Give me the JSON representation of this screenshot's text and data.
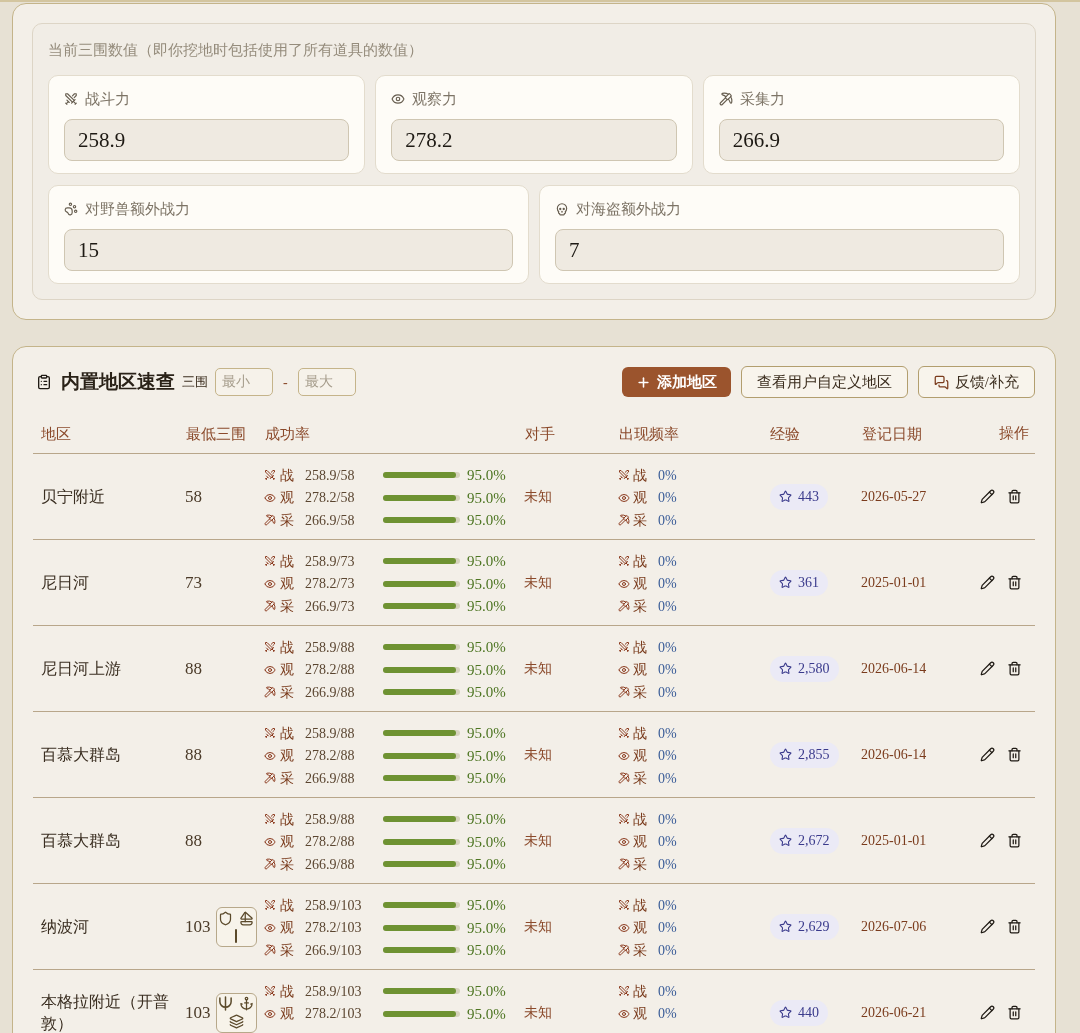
{
  "stats_panel": {
    "caption": "当前三围数值（即你挖地时包括使用了所有道具的数值）",
    "main_stats": [
      {
        "kind": "combat",
        "label": "战斗力",
        "value": "258.9"
      },
      {
        "kind": "observe",
        "label": "观察力",
        "value": "278.2"
      },
      {
        "kind": "gather",
        "label": "采集力",
        "value": "266.9"
      }
    ],
    "bonus_stats": [
      {
        "kind": "beast",
        "label": "对野兽额外战力",
        "value": "15"
      },
      {
        "kind": "pirate",
        "label": "对海盗额外战力",
        "value": "7"
      }
    ]
  },
  "regions_panel": {
    "title": "内置地区速查",
    "filter": {
      "label": "三围",
      "min_placeholder": "最小",
      "separator": "-",
      "max_placeholder": "最大"
    },
    "buttons": [
      {
        "kind": "add",
        "label": "添加地区"
      },
      {
        "kind": "plain",
        "label": "查看用户自定义地区"
      },
      {
        "kind": "feedback",
        "label": "反馈/补充"
      }
    ],
    "table": {
      "columns": [
        "地区",
        "最低三围",
        "成功率",
        "对手",
        "出现频率",
        "经验",
        "登记日期",
        "操作"
      ],
      "rows": [
        {
          "region": "贝宁附近",
          "min_stat": "58",
          "success": [
            {
              "kind": "combat",
              "label": "战",
              "ratio": "258.9/58",
              "level": 0.95,
              "reading": "95.0%"
            },
            {
              "kind": "observe",
              "label": "观",
              "ratio": "278.2/58",
              "level": 0.95,
              "reading": "95.0%"
            },
            {
              "kind": "gather",
              "label": "采",
              "ratio": "266.9/58",
              "level": 0.95,
              "reading": "95.0%"
            }
          ],
          "opponent": "未知",
          "frequency": [
            {
              "kind": "combat",
              "label": "战",
              "reading": "0%"
            },
            {
              "kind": "observe",
              "label": "观",
              "reading": "0%"
            },
            {
              "kind": "gather",
              "label": "采",
              "reading": "0%"
            }
          ],
          "exp": "443",
          "date": "2026-05-27"
        },
        {
          "region": "尼日河",
          "min_stat": "73",
          "success": [
            {
              "kind": "combat",
              "label": "战",
              "ratio": "258.9/73",
              "level": 0.95,
              "reading": "95.0%"
            },
            {
              "kind": "observe",
              "label": "观",
              "ratio": "278.2/73",
              "level": 0.95,
              "reading": "95.0%"
            },
            {
              "kind": "gather",
              "label": "采",
              "ratio": "266.9/73",
              "level": 0.95,
              "reading": "95.0%"
            }
          ],
          "opponent": "未知",
          "frequency": [
            {
              "kind": "combat",
              "label": "战",
              "reading": "0%"
            },
            {
              "kind": "observe",
              "label": "观",
              "reading": "0%"
            },
            {
              "kind": "gather",
              "label": "采",
              "reading": "0%"
            }
          ],
          "exp": "361",
          "date": "2025-01-01"
        },
        {
          "region": "尼日河上游",
          "min_stat": "88",
          "success": [
            {
              "kind": "combat",
              "label": "战",
              "ratio": "258.9/88",
              "level": 0.95,
              "reading": "95.0%"
            },
            {
              "kind": "observe",
              "label": "观",
              "ratio": "278.2/88",
              "level": 0.95,
              "reading": "95.0%"
            },
            {
              "kind": "gather",
              "label": "采",
              "ratio": "266.9/88",
              "level": 0.95,
              "reading": "95.0%"
            }
          ],
          "opponent": "未知",
          "frequency": [
            {
              "kind": "combat",
              "label": "战",
              "reading": "0%"
            },
            {
              "kind": "observe",
              "label": "观",
              "reading": "0%"
            },
            {
              "kind": "gather",
              "label": "采",
              "reading": "0%"
            }
          ],
          "exp": "2,580",
          "date": "2026-06-14"
        },
        {
          "region": "百慕大群岛",
          "min_stat": "88",
          "success": [
            {
              "kind": "combat",
              "label": "战",
              "ratio": "258.9/88",
              "level": 0.95,
              "reading": "95.0%"
            },
            {
              "kind": "observe",
              "label": "观",
              "ratio": "278.2/88",
              "level": 0.95,
              "reading": "95.0%"
            },
            {
              "kind": "gather",
              "label": "采",
              "ratio": "266.9/88",
              "level": 0.95,
              "reading": "95.0%"
            }
          ],
          "opponent": "未知",
          "frequency": [
            {
              "kind": "combat",
              "label": "战",
              "reading": "0%"
            },
            {
              "kind": "observe",
              "label": "观",
              "reading": "0%"
            },
            {
              "kind": "gather",
              "label": "采",
              "reading": "0%"
            }
          ],
          "exp": "2,855",
          "date": "2026-06-14"
        },
        {
          "region": "百慕大群岛",
          "min_stat": "88",
          "success": [
            {
              "kind": "combat",
              "label": "战",
              "ratio": "258.9/88",
              "level": 0.95,
              "reading": "95.0%"
            },
            {
              "kind": "observe",
              "label": "观",
              "ratio": "278.2/88",
              "level": 0.95,
              "reading": "95.0%"
            },
            {
              "kind": "gather",
              "label": "采",
              "ratio": "266.9/88",
              "level": 0.95,
              "reading": "95.0%"
            }
          ],
          "opponent": "未知",
          "frequency": [
            {
              "kind": "combat",
              "label": "战",
              "reading": "0%"
            },
            {
              "kind": "observe",
              "label": "观",
              "reading": "0%"
            },
            {
              "kind": "gather",
              "label": "采",
              "reading": "0%"
            }
          ],
          "exp": "2,672",
          "date": "2025-01-01"
        },
        {
          "region": "纳波河",
          "min_stat": "103",
          "tags": [
            {
              "kind": "shield"
            },
            {
              "kind": "sailboat"
            },
            {
              "kind": "line"
            }
          ],
          "success": [
            {
              "kind": "combat",
              "label": "战",
              "ratio": "258.9/103",
              "level": 0.95,
              "reading": "95.0%"
            },
            {
              "kind": "observe",
              "label": "观",
              "ratio": "278.2/103",
              "level": 0.95,
              "reading": "95.0%"
            },
            {
              "kind": "gather",
              "label": "采",
              "ratio": "266.9/103",
              "level": 0.95,
              "reading": "95.0%"
            }
          ],
          "opponent": "未知",
          "frequency": [
            {
              "kind": "combat",
              "label": "战",
              "reading": "0%"
            },
            {
              "kind": "observe",
              "label": "观",
              "reading": "0%"
            },
            {
              "kind": "gather",
              "label": "采",
              "reading": "0%"
            }
          ],
          "exp": "2,629",
          "date": "2026-07-06"
        },
        {
          "region": "本格拉附近（开普敦）",
          "min_stat": "103",
          "tags": [
            {
              "kind": "trident"
            },
            {
              "kind": "anchor"
            },
            {
              "kind": "layers"
            }
          ],
          "success": [
            {
              "kind": "combat",
              "label": "战",
              "ratio": "258.9/103",
              "level": 0.95,
              "reading": "95.0%"
            },
            {
              "kind": "observe",
              "label": "观",
              "ratio": "278.2/103",
              "level": 0.95,
              "reading": "95.0%"
            }
          ],
          "opponent": "未知",
          "frequency": [
            {
              "kind": "combat",
              "label": "战",
              "reading": "0%"
            },
            {
              "kind": "observe",
              "label": "观",
              "reading": "0%"
            }
          ],
          "exp": "440",
          "date": "2026-06-21"
        }
      ]
    }
  }
}
